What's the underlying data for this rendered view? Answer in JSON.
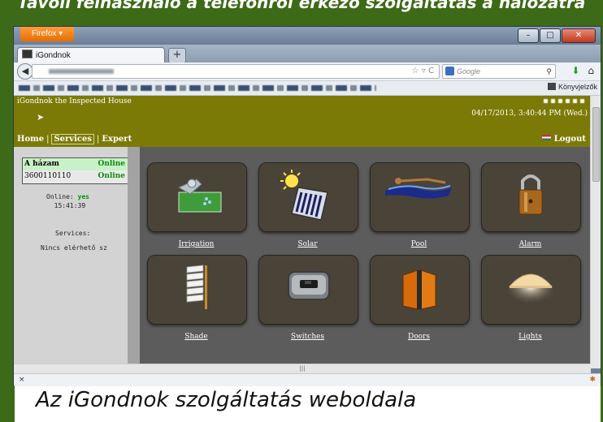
{
  "top_caption": "Távoli felhasználó a telefonról érkező szolgáltatás a hálózatra",
  "browser": {
    "app_button": "Firefox",
    "tab_title": "iGondnok",
    "new_tab": "+",
    "search_placeholder": "Google",
    "bookmarks_label": "Könyvjelzők",
    "window_buttons": {
      "minimize": "–",
      "maximize": "□",
      "close": "✕"
    }
  },
  "site": {
    "title": "iGondnok the Inspected House",
    "datetime": "04/17/2013, 3:40:44 PM (Wed.)",
    "nav": [
      "Home",
      "Services",
      "Expert"
    ],
    "logout": "Logout"
  },
  "sidebar": {
    "devices": [
      {
        "name": "A házam",
        "status": "Online"
      },
      {
        "name": "3600110110",
        "status": "Online"
      }
    ],
    "online_label": "Online:",
    "online_value": "yes",
    "time": "15:41:39",
    "services_label": "Services:",
    "services_value": "Nincs elérhető sz"
  },
  "tiles": [
    {
      "label": "Irrigation",
      "icon": "irrigation-icon"
    },
    {
      "label": "Solar",
      "icon": "solar-panel-icon"
    },
    {
      "label": "Pool",
      "icon": "swimmer-icon"
    },
    {
      "label": "Alarm",
      "icon": "padlock-icon"
    },
    {
      "label": "Shade",
      "icon": "shade-blind-icon"
    },
    {
      "label": "Switches",
      "icon": "switch-icon"
    },
    {
      "label": "Doors",
      "icon": "door-icon"
    },
    {
      "label": "Lights",
      "icon": "lamp-icon"
    }
  ],
  "status_bar": {
    "close": "×"
  },
  "bottom_caption": "Az iGondnok szolgáltatás weboldala"
}
